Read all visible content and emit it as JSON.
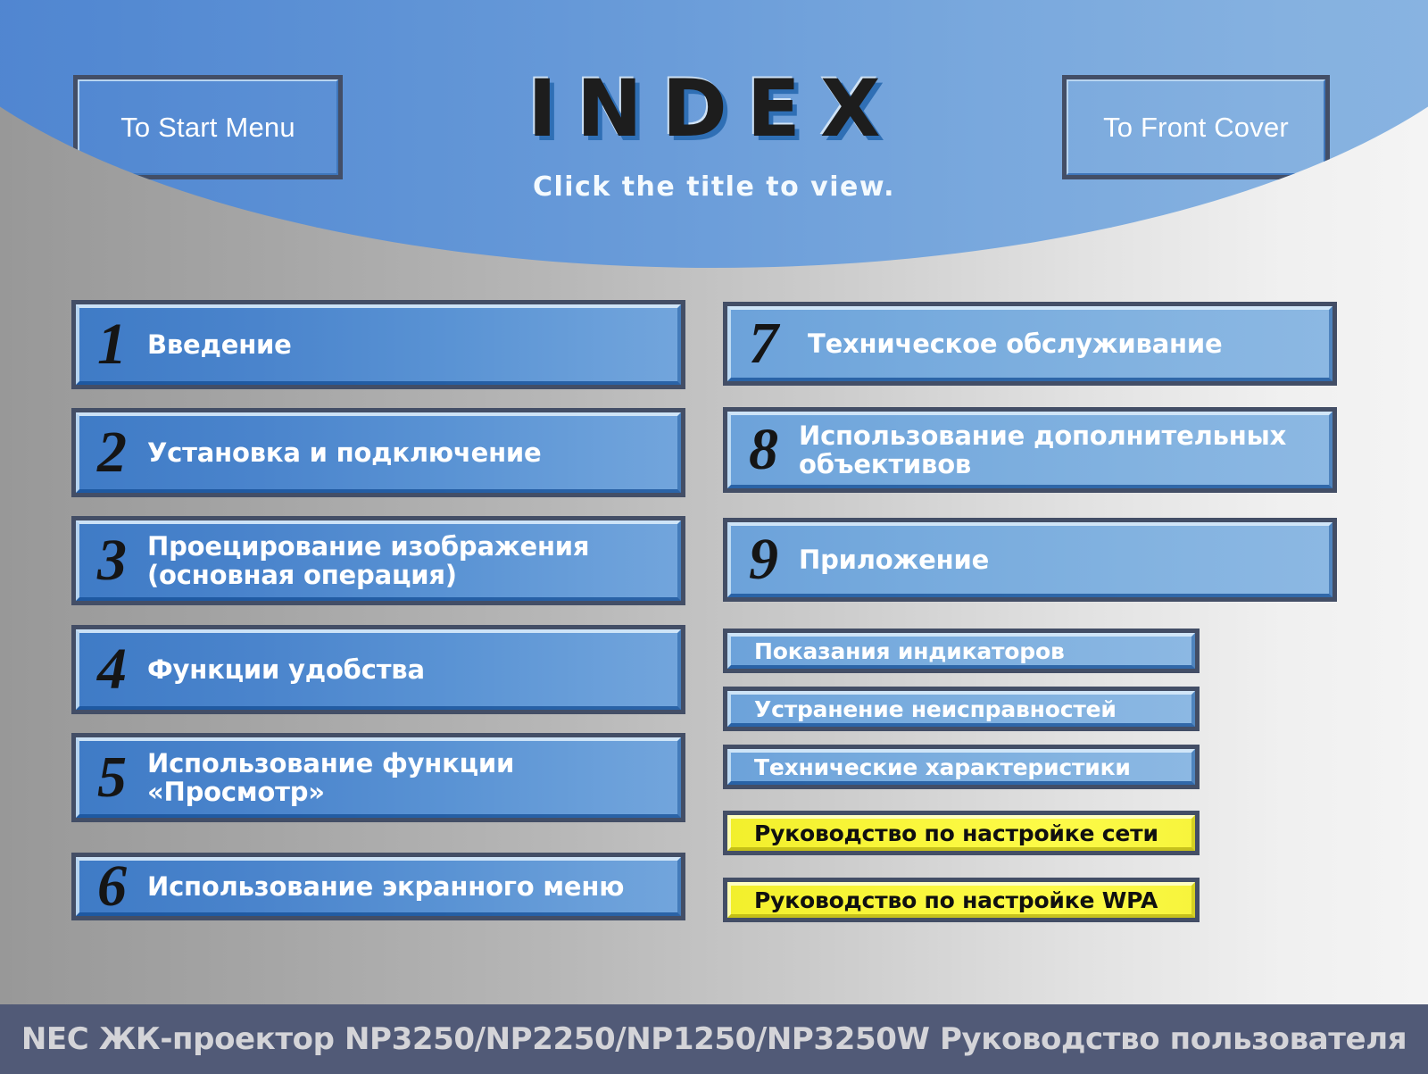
{
  "header": {
    "title": "INDEX",
    "subtitle": "Click the title to view.",
    "nav_start_label": "To Start Menu",
    "nav_cover_label": "To Front Cover"
  },
  "colors": {
    "header_blue": "#6699d8",
    "button_blue_left": "#4a84cc",
    "button_blue_right": "#82b2e0",
    "highlight_yellow": "#f9f63a",
    "footer_bar": "#515a77",
    "border_dark": "#434e66",
    "title_dark": "#1d1d1d"
  },
  "left_column": [
    {
      "number": "1",
      "label": "Введение"
    },
    {
      "number": "2",
      "label": "Установка и подключение"
    },
    {
      "number": "3",
      "label": "Проецирование изображения\n(основная операция)"
    },
    {
      "number": "4",
      "label": "Функции удобства"
    },
    {
      "number": "5",
      "label": "Использование функции\n«Просмотр»"
    },
    {
      "number": "6",
      "label": "Использование экранного меню"
    }
  ],
  "right_column": [
    {
      "number": "7",
      "label": "Техническое обслуживание"
    },
    {
      "number": "8",
      "label": "Использование дополнительных\nобъективов"
    },
    {
      "number": "9",
      "label": "Приложение"
    }
  ],
  "sub_items": [
    {
      "bullet": "circle-bullet-icon",
      "label": "Показания индикаторов",
      "highlight": false
    },
    {
      "bullet": "circle-bullet-icon",
      "label": "Устранение неисправностей",
      "highlight": false
    },
    {
      "bullet": "circle-bullet-icon",
      "label": "Технические характеристики",
      "highlight": false
    },
    {
      "bullet": "square-bullet-icon",
      "label": "Руководство по настройке сети",
      "highlight": true
    },
    {
      "bullet": "square-bullet-icon",
      "label": "Руководство по настройке WPA",
      "highlight": true
    }
  ],
  "footer": {
    "text": "NEC ЖК-проектор NP3250/NP2250/NP1250/NP3250W Руководство пользователя"
  }
}
